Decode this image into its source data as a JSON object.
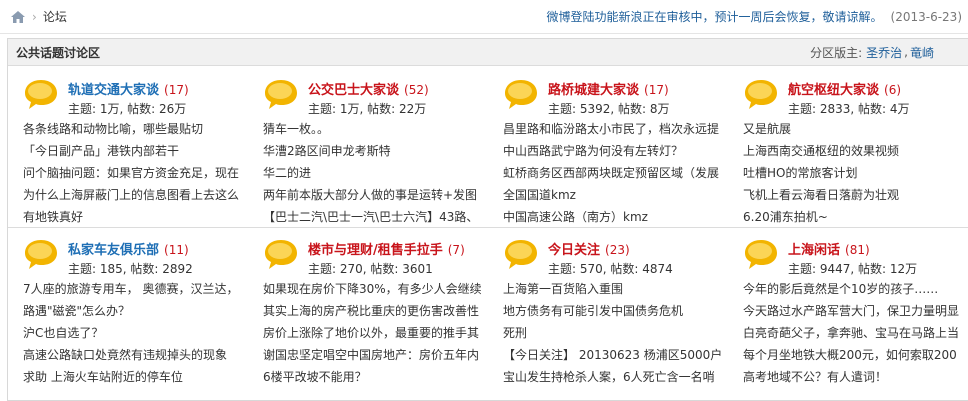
{
  "breadcrumb": {
    "current": "论坛",
    "separator": "›"
  },
  "notice": {
    "text": "微博登陆功能新浪正在审核中，预计一周后会恢复，敬请谅解。",
    "date": "(2013-6-23)"
  },
  "panel": {
    "title": "公共话题讨论区",
    "moderator_label": "分区版主:",
    "moderators": [
      "圣乔治",
      "竜崎"
    ],
    "moderator_sep": ","
  },
  "forums": [
    {
      "name": "轨道交通大家谈",
      "count": "(17)",
      "color": "blue",
      "stats": "主题: 1万, 帖数: 26万",
      "posts": [
        "各条线路和动物比喻，哪些最贴切",
        "「今日副产品」港铁内部若干",
        "问个脑抽问题：如果官方资金充足，现在为什么上海屏蔽门上的信息图看上去这么",
        "为什么上海屏蔽门上的信息图看上去这么",
        "有地铁真好"
      ]
    },
    {
      "name": "公交巴士大家谈",
      "count": "(52)",
      "color": "red",
      "stats": "主题: 1万, 帖数: 22万",
      "posts": [
        "猜车一枚。。",
        "华漕2路区间申龙考斯特",
        "华二的进",
        "两年前本版大部分人做的事是运转+发图",
        "【巴士二汽\\巴士一汽\\巴士六汽】43路、"
      ]
    },
    {
      "name": "路桥城建大家谈",
      "count": "(17)",
      "color": "red",
      "stats": "主题: 5392, 帖数: 8万",
      "posts": [
        "昌里路和临汾路太小市民了，档次永远提",
        "中山西路武宁路为何没有左转灯？",
        "虹桥商务区西部两块既定预留区域（发展",
        "全国国道kmz",
        "中国高速公路（南方）kmz"
      ]
    },
    {
      "name": "航空枢纽大家谈",
      "count": "(6)",
      "color": "red",
      "stats": "主题: 2833, 帖数: 4万",
      "posts": [
        "又是航展",
        "上海西南交通枢纽的效果视频",
        "吐槽HO的常旅客计划",
        "飞机上看云海看日落蔚为壮观",
        "6.20浦东拍机~"
      ]
    },
    {
      "name": "私家车友俱乐部",
      "count": "(11)",
      "color": "blue",
      "stats": "主题: 185, 帖数: 2892",
      "posts": [
        "7人座的旅游专用车， 奥德赛，汉兰达，",
        "路遇\"磁瓷\"怎么办？",
        "沪C也自选了？",
        "高速公路缺口处竟然有违规掉头的现象",
        "求助 上海火车站附近的停车位"
      ]
    },
    {
      "name": "楼市与理财/租售手拉手",
      "count": "(7)",
      "color": "red",
      "stats": "主题: 270, 帖数: 3601",
      "posts": [
        "如果现在房价下降30%，有多少人会继续",
        "其实上海的房产税比重庆的更伤害改善性",
        "房价上涨除了地价以外，最重要的推手其",
        "谢国忠坚定唱空中国房地产：房价五年内",
        "6楼平改坡不能用？"
      ]
    },
    {
      "name": "今日关注",
      "count": "(23)",
      "color": "red",
      "stats": "主题: 570, 帖数: 4874",
      "posts": [
        "上海第一百货陷入重围",
        "地方债务有可能引发中国债务危机",
        "死刑",
        "【今日关注】 20130623 杨浦区5000户",
        "宝山发生持枪杀人案，6人死亡含一名哨"
      ]
    },
    {
      "name": "上海闲话",
      "count": "(81)",
      "color": "red",
      "stats": "主题: 9447, 帖数: 12万",
      "posts": [
        "今年的影后竟然是个10岁的孩子……",
        "今天路过水产路军营大门，保卫力量明显",
        "白亮奇葩父子，拿奔驰、宝马在马路上当",
        "每个月坐地铁大概200元，如何索取200",
        "高考地域不公？有人遣词！"
      ]
    }
  ],
  "colors": {
    "link_blue": "#1f6fb5",
    "title_red": "#c8141b",
    "bubble": "#f7c200"
  }
}
